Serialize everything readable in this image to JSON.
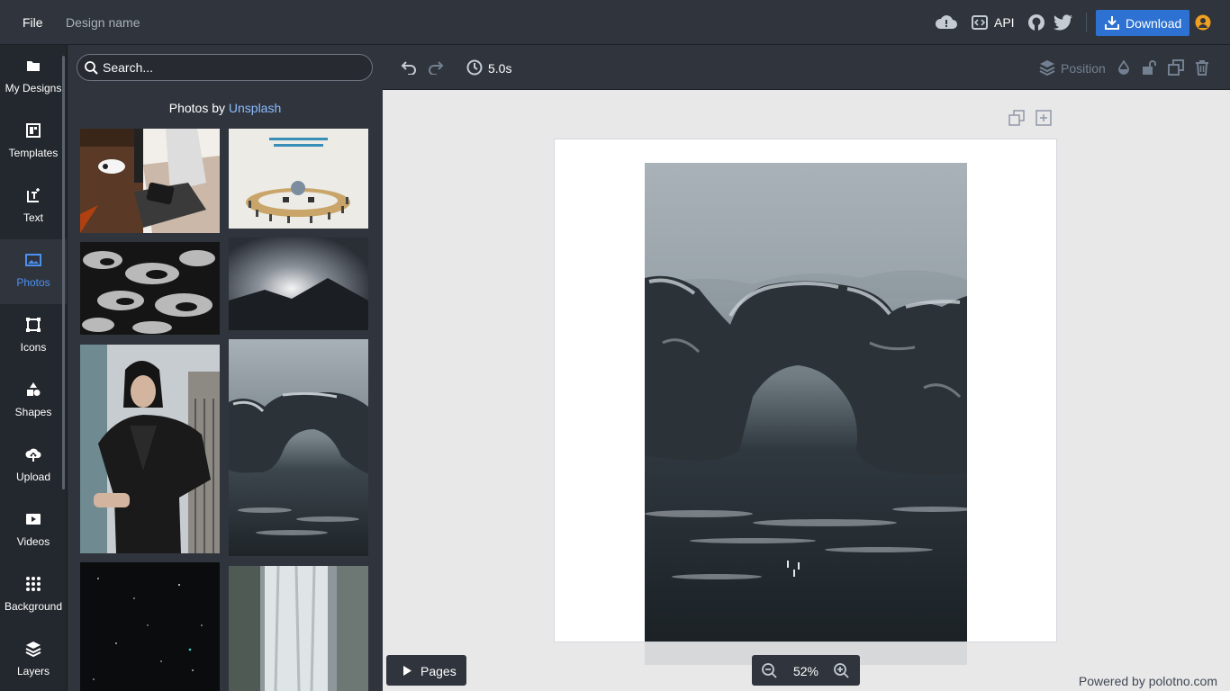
{
  "header": {
    "file_label": "File",
    "design_name": "Design name",
    "api_label": "API",
    "download_label": "Download",
    "icons": [
      "cloud-save-icon",
      "api-code-icon",
      "github-icon",
      "twitter-icon",
      "download-icon",
      "user-icon"
    ]
  },
  "sidebar": {
    "items": [
      {
        "label": "My Designs",
        "icon": "folder-icon"
      },
      {
        "label": "Templates",
        "icon": "templates-icon"
      },
      {
        "label": "Text",
        "icon": "text-icon"
      },
      {
        "label": "Photos",
        "icon": "photo-icon",
        "active": true
      },
      {
        "label": "Icons",
        "icon": "icons-icon"
      },
      {
        "label": "Shapes",
        "icon": "shapes-icon"
      },
      {
        "label": "Upload",
        "icon": "upload-icon"
      },
      {
        "label": "Videos",
        "icon": "video-icon"
      },
      {
        "label": "Background",
        "icon": "grid-icon"
      },
      {
        "label": "Layers",
        "icon": "layers-icon"
      }
    ]
  },
  "panel": {
    "search_placeholder": "Search...",
    "credit_prefix": "Photos by",
    "credit_link": "Unsplash"
  },
  "toolbar": {
    "duration": "5.0s",
    "position_label": "Position"
  },
  "footer": {
    "pages_label": "Pages",
    "zoom": "52%",
    "powered_by": "Powered by polotno.com"
  },
  "colors": {
    "accent": "#2d72d2",
    "active_nav": "#4c90f0",
    "link": "#8abbff",
    "dark_bg": "#30353d"
  }
}
